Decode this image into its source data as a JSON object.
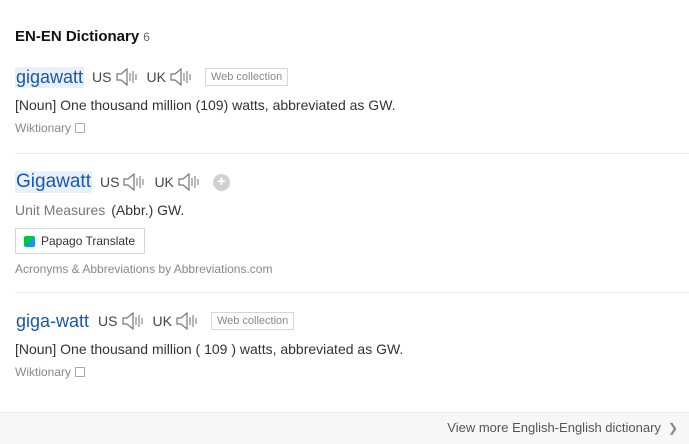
{
  "header": {
    "title": "EN-EN Dictionary",
    "count": "6"
  },
  "entries": [
    {
      "word": "gigawatt",
      "us_label": "US",
      "uk_label": "UK",
      "tag": "Web collection",
      "definition": "[Noun] One thousand million (109) watts, abbreviated as GW.",
      "source": "Wiktionary"
    },
    {
      "word": "Gigawatt",
      "us_label": "US",
      "uk_label": "UK",
      "unit_label": "Unit Measures",
      "unit_value": "(Abbr.) GW.",
      "translate_label": "Papago Translate",
      "source": "Acronyms & Abbreviations by Abbreviations.com"
    },
    {
      "word": "giga-watt",
      "us_label": "US",
      "uk_label": "UK",
      "tag": "Web collection",
      "definition": "[Noun] One thousand million ( 109 ) watts, abbreviated as GW.",
      "source": "Wiktionary"
    }
  ],
  "footer": {
    "more_label": "View more English-English dictionary"
  },
  "colors": {
    "word": "#1a56b5",
    "highlight": "#e8f0fb"
  },
  "icons": {
    "speaker": "speaker-icon",
    "add": "plus-icon",
    "external": "external-link-icon",
    "chevron": "chevron-right-icon"
  }
}
